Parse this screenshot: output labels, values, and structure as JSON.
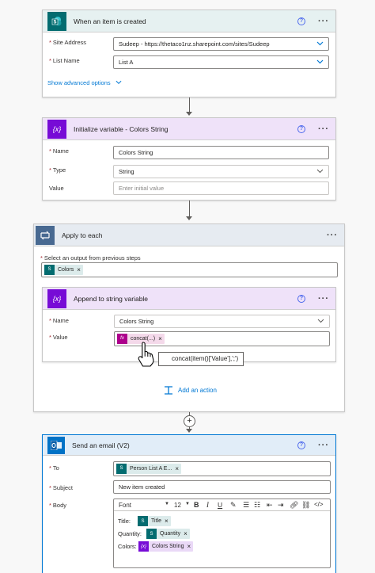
{
  "trigger": {
    "title": "When an item is created",
    "site_label": "Site Address",
    "site_value": "Sudeep - https://thetaco1nz.sharepoint.com/sites/Sudeep",
    "list_label": "List Name",
    "list_value": "List A",
    "advanced": "Show advanced options"
  },
  "init_var": {
    "title": "Initialize variable - Colors String",
    "name_label": "Name",
    "name_value": "Colors String",
    "type_label": "Type",
    "type_value": "String",
    "value_label": "Value",
    "value_placeholder": "Enter initial value"
  },
  "apply": {
    "title": "Apply to each",
    "select_label": "Select an output from previous steps",
    "token": "Colors",
    "add_action": "Add an action"
  },
  "append": {
    "title": "Append to string variable",
    "name_label": "Name",
    "name_value": "Colors String",
    "value_label": "Value",
    "token": "concat(...)",
    "tooltip": "concat(item()['Value'],';')"
  },
  "email": {
    "title": "Send an email (V2)",
    "to_label": "To",
    "to_token": "Person List A E...",
    "subject_label": "Subject",
    "subject_value": "New item created",
    "body_label": "Body",
    "font": "Font",
    "size": "12",
    "body_lines": [
      {
        "label": "Title:",
        "token": "Title"
      },
      {
        "label": "Quantity:",
        "token": "Quantity"
      },
      {
        "label": "Colors:",
        "token": "Colors String"
      }
    ]
  },
  "colors": {
    "sharepoint": "#036c70",
    "variable": "#770bd6",
    "loop": "#486991",
    "outlook": "#0072c6",
    "link": "#0078d4"
  }
}
